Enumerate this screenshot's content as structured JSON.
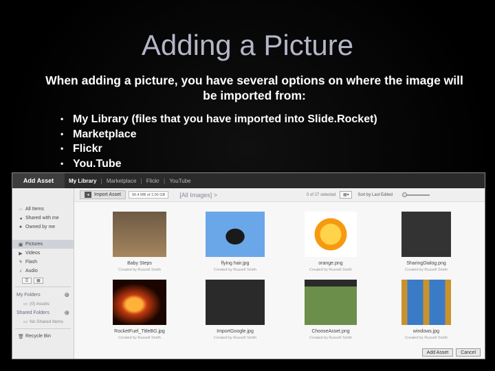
{
  "slide": {
    "title": "Adding a Picture",
    "intro": "When adding a picture, you have several options on where the image will be imported from:",
    "bullets": [
      "My Library (files that you have imported into Slide.Rocket)",
      "Marketplace",
      "Flickr",
      "You.Tube"
    ]
  },
  "dialog": {
    "title": "Add Asset",
    "tabs": [
      "My Library",
      "Marketplace",
      "Flickr",
      "YouTube"
    ],
    "active_tab": "My Library",
    "sidebar": {
      "items": [
        {
          "label": "All Items",
          "icon": "grid-icon"
        },
        {
          "label": "Shared with me",
          "icon": "share-icon"
        },
        {
          "label": "Owned by me",
          "icon": "person-icon"
        },
        {
          "label": "Pictures",
          "icon": "picture-icon",
          "active": true
        },
        {
          "label": "Videos",
          "icon": "video-icon"
        },
        {
          "label": "Flash",
          "icon": "flash-icon"
        },
        {
          "label": "Audio",
          "icon": "audio-icon"
        }
      ],
      "my_folders_label": "My Folders",
      "my_folders_empty": "(0) Assets",
      "shared_folders_label": "Shared Folders",
      "shared_folders_empty": "No Shared Items",
      "recycle_bin": "Recycle Bin"
    },
    "toolbar": {
      "import_label": "Import Asset",
      "quota": "96.4 MB of 1.00 GB",
      "breadcrumb": "[All Images] >",
      "selection": "0 of 27 selected",
      "sort": "Sort by Last Edited"
    },
    "assets": [
      {
        "name": "Baby Steps",
        "credit": "Created by Russell Smith",
        "color": "#8a6a4a"
      },
      {
        "name": "flying hair.jpg",
        "credit": "Created by Russell Smith",
        "color": "#3a7bc8"
      },
      {
        "name": "orange.png",
        "credit": "Created by Russell Smith",
        "color": "#f59a10"
      },
      {
        "name": "SharingDialog.png",
        "credit": "Created by Russell Smith",
        "color": "#333333"
      },
      {
        "name": "RocketFuel_TitleBG.jpg",
        "credit": "Created by Russell Smith",
        "color": "#c43a10"
      },
      {
        "name": "ImportGoogle.jpg",
        "credit": "Created by Russell Smith",
        "color": "#2a2a2a"
      },
      {
        "name": "ChooseAsset.png",
        "credit": "Created by Russell Smith",
        "color": "#3d4a3a"
      },
      {
        "name": "windows.jpg",
        "credit": "Created by Russell Smith",
        "color": "#c8922e"
      }
    ],
    "buttons": {
      "add": "Add Asset",
      "cancel": "Cancel"
    }
  }
}
